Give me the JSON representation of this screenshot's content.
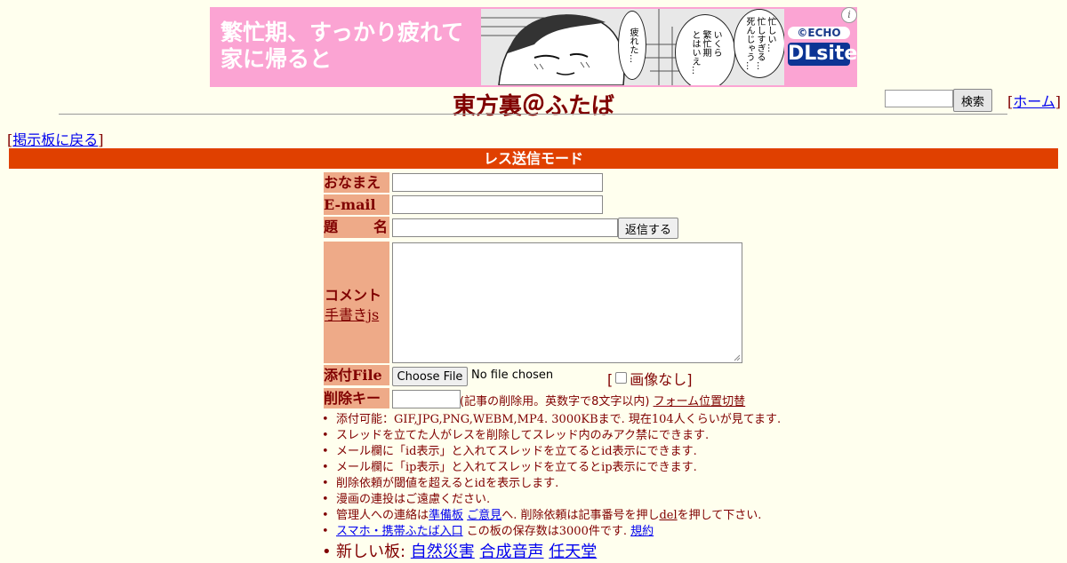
{
  "banner": {
    "line1": "繁忙期、すっかり疲れて",
    "line2": "家に帰ると",
    "bubble_left": "疲れた…",
    "bubble_mid": "いくら\n繁忙期\nとはいえ…",
    "bubble_right": "忙しい…\n忙しすぎる…\n死んじゃう…",
    "logo_copyright": "©ECHO",
    "logo_brand": "DLsite",
    "info_glyph": "i",
    "bg_color": "#fba4d3",
    "brand_color": "#0c3494"
  },
  "header": {
    "title": "東方裏＠ふたば",
    "search_button": "検索",
    "search_value": "",
    "home_open": "[",
    "home_label": "ホーム",
    "home_close": "]"
  },
  "nav": {
    "back_open": "[",
    "back_label": "掲示板に戻る",
    "back_close": "]"
  },
  "mode_bar": {
    "label": "レス送信モード",
    "color": "#e04000"
  },
  "form": {
    "name_label": "おなまえ",
    "email_label": "E-mail",
    "subject_label_a": "題",
    "subject_label_b": "名",
    "submit_button": "返信する",
    "comment_label": "コメント",
    "tegaki_link": "手書きjs",
    "file_label": "添付File",
    "file_button": "Choose File",
    "file_status": "No file chosen",
    "noimage_open": "[",
    "noimage_label": "画像なし]",
    "delkey_label": "削除キー",
    "delkey_note": "(記事の削除用。英数字で8文字以内)",
    "form_position_link": "フォーム位置切替",
    "label_bg": "#eeaa88"
  },
  "notes": {
    "n1": "添付可能：GIF,JPG,PNG,WEBM,MP4. 3000KBまで. 現在104人くらいが見てます.",
    "n2": "スレッドを立てた人がレスを削除してスレッド内のみアク禁にできます.",
    "n3": "メール欄に「id表示」と入れてスレッドを立てるとid表示にできます.",
    "n4": "メール欄に「ip表示」と入れてスレッドを立てるとip表示にできます.",
    "n5": "削除依頼が閾値を超えるとidを表示します.",
    "n6": "漫画の連投はご遠慮ください.",
    "n7_pre": "管理人への連絡は",
    "n7_link1": "準備板",
    "n7_link2": "ご意見",
    "n7_mid": "へ. 削除依頼は記事番号を押し",
    "n7_link3": "del",
    "n7_post": "を押して下さい.",
    "n8_link1": "スマホ・携帯ふたば入口",
    "n8_mid": " この板の保存数は3000件です. ",
    "n8_link2": "規約",
    "n9_pre": "新しい板: ",
    "n9_links": [
      "自然災害",
      "合成音声",
      "任天堂"
    ]
  }
}
